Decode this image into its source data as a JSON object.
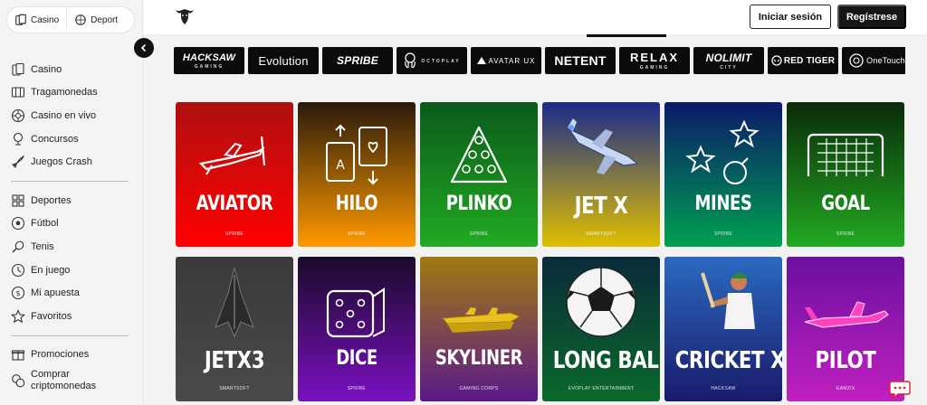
{
  "switcher": {
    "casino": "Casino",
    "deport": "Deport"
  },
  "nav": {
    "group1": [
      {
        "label": "Casino",
        "icon": "cards-icon"
      },
      {
        "label": "Tragamonedas",
        "icon": "slot-icon"
      },
      {
        "label": "Casino en vivo",
        "icon": "roulette-icon"
      },
      {
        "label": "Concursos",
        "icon": "trophy-icon"
      },
      {
        "label": "Juegos Crash",
        "icon": "rocket-icon"
      }
    ],
    "group2": [
      {
        "label": "Deportes",
        "icon": "grid-icon"
      },
      {
        "label": "Fútbol",
        "icon": "football-icon"
      },
      {
        "label": "Tenis",
        "icon": "tennis-icon"
      },
      {
        "label": "En juego",
        "icon": "live-icon"
      },
      {
        "label": "Mi apuesta",
        "icon": "coin-icon"
      },
      {
        "label": "Favoritos",
        "icon": "star-icon"
      }
    ],
    "group3": [
      {
        "label": "Promociones",
        "icon": "gift-icon"
      },
      {
        "label": "Comprar criptomonedas",
        "icon": "crypto-icon"
      }
    ]
  },
  "header": {
    "login": "Iniciar sesión",
    "register": "Regístrese"
  },
  "providers": [
    {
      "name": "HACKSAW",
      "sub": "GAMING"
    },
    {
      "name": "Evolution",
      "sub": ""
    },
    {
      "name": "SPRIBE",
      "sub": ""
    },
    {
      "name": "",
      "sub": "OCTOPLAY"
    },
    {
      "name": "AVATAR UX",
      "sub": ""
    },
    {
      "name": "NETENT",
      "sub": ""
    },
    {
      "name": "RELAX",
      "sub": "GAMING"
    },
    {
      "name": "NOLIMIT",
      "sub": "CITY"
    },
    {
      "name": "RED TIGER",
      "sub": ""
    },
    {
      "name": "OneTouch",
      "sub": ""
    }
  ],
  "games": [
    {
      "title": "AVIATOR",
      "provider": "SPRIBE",
      "bg": [
        "#b01010",
        "#ff0000"
      ],
      "icon": "plane-icon"
    },
    {
      "title": "HILO",
      "provider": "SPRIBE",
      "bg": [
        "#2a1a0a",
        "#ff9900"
      ],
      "icon": "playing-cards-icon"
    },
    {
      "title": "PLINKO",
      "provider": "SPRIBE",
      "bg": [
        "#0a5a1a",
        "#22aa22"
      ],
      "icon": "plinko-icon"
    },
    {
      "title": "JET X",
      "provider": "SMARTSOFT",
      "bg": [
        "#1a2a8a",
        "#e0c000"
      ],
      "icon": "jet-icon"
    },
    {
      "title": "MINES",
      "provider": "SPRIBE",
      "bg": [
        "#0a1a6a",
        "#00a050"
      ],
      "icon": "mines-icon"
    },
    {
      "title": "GOAL",
      "provider": "SPRIBE",
      "bg": [
        "#0a2a0a",
        "#22aa22"
      ],
      "icon": "goal-icon"
    },
    {
      "title": "JETX3",
      "provider": "SMARTSOFT",
      "bg": [
        "#3a3a3a",
        "#4a4a4a"
      ],
      "icon": "spaceship-icon"
    },
    {
      "title": "DICE",
      "provider": "SPRIBE",
      "bg": [
        "#1a0a2a",
        "#7a10c0"
      ],
      "icon": "dice-icon"
    },
    {
      "title": "SKYLINER",
      "provider": "GAMING CORPS",
      "bg": [
        "#a07a10",
        "#5a1a8a"
      ],
      "icon": "airship-icon"
    },
    {
      "title": "LONG BALL",
      "provider": "EVOPLAY ENTERTAINMENT",
      "bg": [
        "#0a2a3a",
        "#0a6a2a"
      ],
      "icon": "soccer-ball-icon"
    },
    {
      "title": "CRICKET X",
      "provider": "HACKSAW",
      "bg": [
        "#2a6ac0",
        "#1a1a6a"
      ],
      "icon": "cricket-player-icon"
    },
    {
      "title": "PILOT",
      "provider": "GAMZIX",
      "bg": [
        "#6a10a0",
        "#c020c0"
      ],
      "icon": "neon-plane-icon"
    }
  ]
}
